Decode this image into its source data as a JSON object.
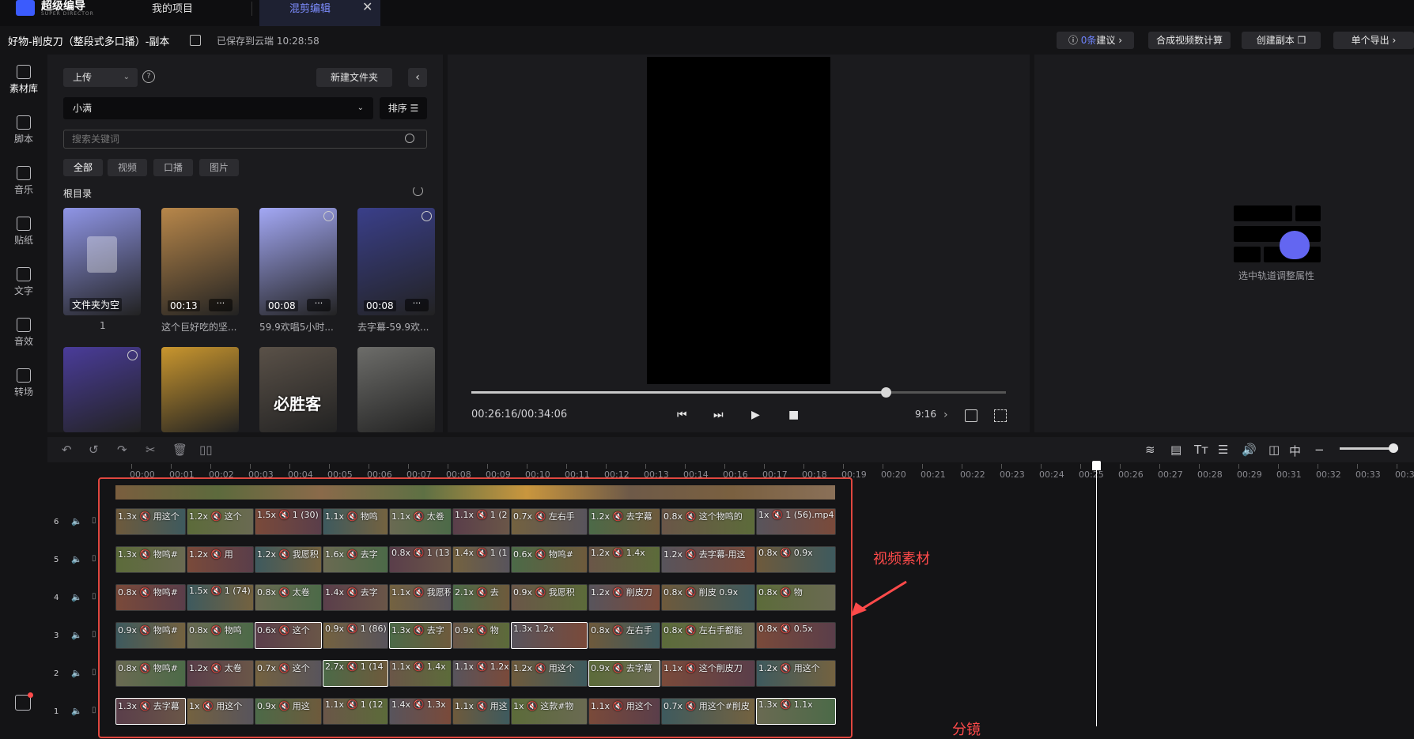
{
  "app": {
    "logo": "超级编导",
    "logo_sub": "SUPER DIRECTOR"
  },
  "tabs": {
    "projects": "我的项目",
    "edit": "混剪编辑",
    "close": "✕"
  },
  "project": {
    "title": "好物-削皮刀（整段式多口播）-副本",
    "save_status": "已保存到云端 10:28:58"
  },
  "top_buttons": {
    "suggest_count": "0条",
    "suggest": "建议",
    "stats": "合成视频数计算",
    "copy": "创建副本",
    "export": "单个导出"
  },
  "sidebar": [
    {
      "label": "素材库",
      "icon": "library-icon"
    },
    {
      "label": "脚本",
      "icon": "script-icon"
    },
    {
      "label": "音乐",
      "icon": "music-icon"
    },
    {
      "label": "贴纸",
      "icon": "sticker-icon"
    },
    {
      "label": "文字",
      "icon": "text-icon"
    },
    {
      "label": "音效",
      "icon": "sound-effect-icon"
    },
    {
      "label": "转场",
      "icon": "transition-icon"
    }
  ],
  "library": {
    "upload": "上传",
    "new_folder": "新建文件夹",
    "folder": "小满",
    "sort": "排序",
    "search_placeholder": "搜索关键词",
    "filters": [
      "全部",
      "视频",
      "口播",
      "图片"
    ],
    "root": "根目录",
    "items": [
      {
        "caption": "1",
        "badge": "文件夹为空",
        "color": "#8f95e6"
      },
      {
        "caption": "这个巨好吃的坚...",
        "duration": "00:13",
        "color": "#b8874a"
      },
      {
        "caption": "59.9欢唱5小时...",
        "duration": "00:08",
        "color": "#a3a8f5"
      },
      {
        "caption": "去字幕-59.9欢...",
        "duration": "00:08",
        "color": "#3a3f8a"
      },
      {
        "caption": "",
        "color": "#4a3c9a"
      },
      {
        "caption": "",
        "color": "#c9962e"
      },
      {
        "caption": "",
        "overlay": "必胜客",
        "color": "#5a5148"
      },
      {
        "caption": "",
        "color": "#6d6d6a"
      }
    ]
  },
  "player": {
    "timecode": "00:26:16/00:34:06",
    "ratio": "9:16",
    "progress": 0.77
  },
  "props": {
    "hint": "选中轨道调整属性"
  },
  "timeline": {
    "ticks": [
      "00:00",
      "00:01",
      "00:02",
      "00:03",
      "00:04",
      "00:05",
      "00:06",
      "00:07",
      "00:08",
      "00:09",
      "00:10",
      "00:11",
      "00:12",
      "00:13",
      "00:14",
      "00:16",
      "00:17",
      "00:18",
      "00:19",
      "00:20",
      "00:21",
      "00:22",
      "00:23",
      "00:24",
      "00:25",
      "00:26",
      "00:27",
      "00:28",
      "00:29",
      "00:31",
      "00:32",
      "00:33",
      "00:34"
    ],
    "tracks": [
      {
        "num": "6",
        "clips": [
          "1.3x 🔇 用这个",
          "1.2x 🔇 这个",
          "1.5x 🔇 1 (30)",
          "1.1x 🔇 物鸣",
          "1.1x 🔇 太卷",
          "1.1x 🔇 1 (2",
          "0.7x 🔇 左右手",
          "1.2x 🔇 去字幕",
          "0.8x 🔇 这个物鸣的",
          "1x 🔇 1 (56).mp4"
        ]
      },
      {
        "num": "5",
        "clips": [
          "1.3x 🔇 物鸣#",
          "1.2x 🔇 用",
          "1.2x 🔇 我愿积",
          "1.6x 🔇 去字",
          "0.8x 🔇 1 (13",
          "1.4x 🔇 1 (1",
          "0.6x 🔇 物鸣#",
          "1.2x 🔇 1.4x",
          "1.2x 🔇 去字幕-用这",
          "0.8x 🔇 0.9x"
        ]
      },
      {
        "num": "4",
        "clips": [
          "0.8x 🔇 物鸣#",
          "1.5x 🔇 1 (74)",
          "0.8x 🔇 太卷",
          "1.4x 🔇 去字",
          "1.1x 🔇 我愿积",
          "2.1x 🔇 去",
          "0.9x 🔇 我愿积",
          "1.2x 🔇 削皮刀",
          "0.8x 🔇 削皮 0.9x",
          "0.8x 🔇 物"
        ]
      },
      {
        "num": "3",
        "clips": [
          "0.9x 🔇 物鸣#",
          "0.8x 🔇 物鸣",
          "0.6x 🔇 这个",
          "0.9x 🔇 1 (86)",
          "1.3x 🔇 去字",
          "0.9x 🔇 物",
          "1.3x 1.2x",
          "0.8x 🔇 左右手",
          "0.8x 🔇 左右手都能",
          "0.8x 🔇 0.5x"
        ]
      },
      {
        "num": "2",
        "clips": [
          "0.8x 🔇 物鸣#",
          "1.2x 🔇 太卷",
          "0.7x 🔇 这个",
          "2.7x 🔇 1 (14",
          "1.1x 🔇 1.4x",
          "1.1x 🔇 1.2x",
          "1.2x 🔇 用这个",
          "0.9x 🔇 去字幕",
          "1.1x 🔇 这个削皮刀",
          "1.2x 🔇 用这个"
        ]
      },
      {
        "num": "1",
        "clips": [
          "1.3x 🔇 去字幕",
          "1x 🔇 用这个",
          "0.9x 🔇 用这",
          "1.1x 🔇 1 (12",
          "1.4x 🔇 1.3x",
          "1.1x 🔇 用这",
          "1x 🔇 这款#物",
          "1.1x 🔇 用这个",
          "0.7x 🔇 用这个#削皮",
          "1.3x 🔇 1.1x"
        ]
      }
    ]
  },
  "annotation": {
    "label": "视频素材",
    "label2": "分镜",
    "color": "#ff4a4a"
  }
}
